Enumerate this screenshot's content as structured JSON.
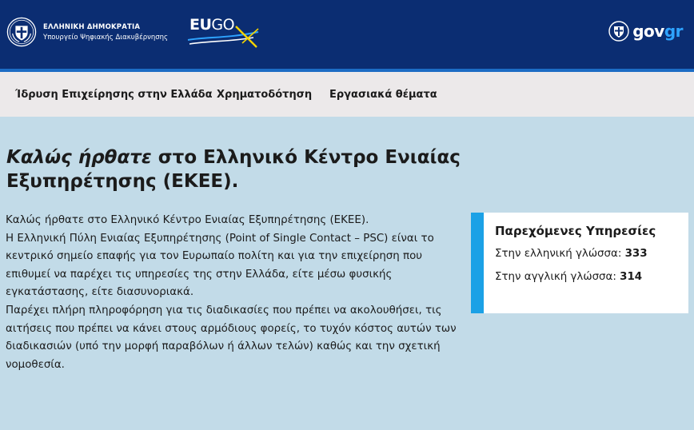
{
  "header": {
    "ministry_title": "ΕΛΛΗΝΙΚΗ ΔΗΜΟΚΡΑΤΙΑ",
    "ministry_subtitle": "Υπουργείο Ψηφιακής Διακυβέρνησης",
    "eugo_logo": {
      "part1": "EU",
      "part2": "GO"
    },
    "govgr_logo": {
      "part1": "gov",
      "part2": "gr"
    },
    "colors": {
      "background": "#0b2d72",
      "stripe": "#1c6cc4",
      "accent": "#2ea3ff",
      "eugo_yellow": "#f5d400"
    },
    "icons": [
      "greek-emblem-icon",
      "eugo-logo",
      "govgr-emblem-icon"
    ]
  },
  "nav": {
    "items": [
      {
        "label": "Ίδρυση Επιχείρησης στην Ελλάδα"
      },
      {
        "label": "Χρηματοδότηση"
      },
      {
        "label": "Εργασιακά θέματα"
      }
    ]
  },
  "main": {
    "title_emphasis": "Καλώς ήρθατε",
    "title_rest": " στο Ελληνικό Κέντρο Ενιαίας Εξυπηρέτησης (ΕΚΕΕ).",
    "paragraphs": [
      "Καλώς ήρθατε στο Ελληνικό Κέντρο Ενιαίας Εξυπηρέτησης (ΕΚΕΕ).",
      "Η Ελληνική Πύλη Ενιαίας Εξυπηρέτησης (Point of Single Contact – PSC) είναι το κεντρικό σημείο επαφής για τον Ευρωπαίο πολίτη και για την επιχείρηση που επιθυμεί να παρέχει τις υπηρεσίες της στην Ελλάδα, είτε μέσω φυσικής εγκατάστασης, είτε διασυνοριακά.",
      "Παρέχει πλήρη πληροφόρηση για τις διαδικασίες που πρέπει να ακολουθήσει, τις αιτήσεις που πρέπει να κάνει στους αρμόδιους φορείς, το τυχόν κόστος αυτών των διαδικασιών (υπό την μορφή παραβόλων ή άλλων τελών) καθώς και την σχετική νομοθεσία."
    ]
  },
  "services": {
    "title": "Παρεχόμενες Υπηρεσίες",
    "greek_label": "Στην ελληνική γλώσσα: ",
    "greek_count": "333",
    "english_label": "Στην αγγλική γλώσσα: ",
    "english_count": "314",
    "accent_color": "#1ba1e6"
  }
}
